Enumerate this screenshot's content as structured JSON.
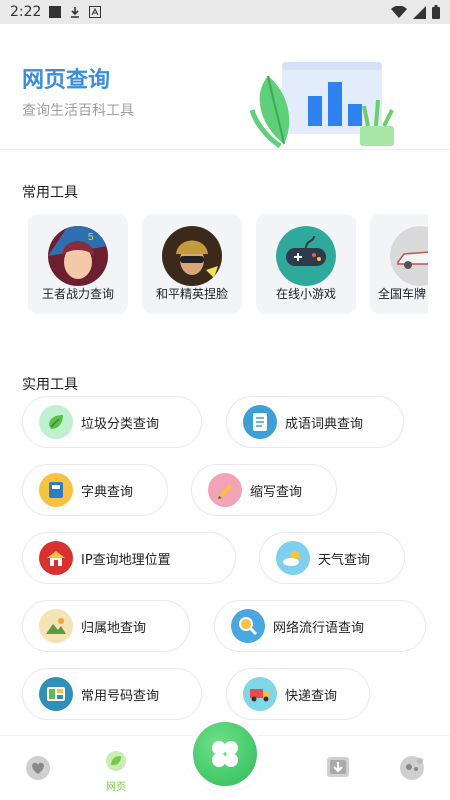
{
  "status_bar": {
    "time": "2:22"
  },
  "header": {
    "title": "网页查询",
    "subtitle": "查询生活百科工具"
  },
  "sections": {
    "common": "常用工具",
    "practical": "实用工具"
  },
  "common_tools": [
    {
      "label": "王者战力查询",
      "icon": "hero-avatar"
    },
    {
      "label": "和平精英捏脸",
      "icon": "soldier-avatar"
    },
    {
      "label": "在线小游戏",
      "icon": "gamepad-icon"
    },
    {
      "label": "全国车牌",
      "icon": "car-icon"
    }
  ],
  "practical_tools": [
    {
      "label": "垃圾分类查询",
      "icon": "leaf-icon",
      "color": "#bff0cf"
    },
    {
      "label": "成语词典查询",
      "icon": "document-icon",
      "color": "#3d9fd3"
    },
    {
      "label": "字典查询",
      "icon": "book-icon",
      "color": "#f5c242"
    },
    {
      "label": "缩写查询",
      "icon": "pencil-icon",
      "color": "#f2a3b5"
    },
    {
      "label": "IP查询地理位置",
      "icon": "house-icon",
      "color": "#d9322e"
    },
    {
      "label": "天气查询",
      "icon": "sun-cloud-icon",
      "color": "#7fd0ef"
    },
    {
      "label": "归属地查询",
      "icon": "landscape-icon",
      "color": "#f3e3b5"
    },
    {
      "label": "网络流行语查询",
      "icon": "magnifier-icon",
      "color": "#4aa8e0"
    },
    {
      "label": "常用号码查询",
      "icon": "layout-icon",
      "color": "#2f8fb8"
    },
    {
      "label": "快递查询",
      "icon": "truck-icon",
      "color": "#7fd7e8"
    }
  ],
  "bottom_nav": {
    "active_label": "网页"
  },
  "colors": {
    "accent": "#3a8de0",
    "green": "#2dbb58",
    "nav_active": "#7cc84f"
  }
}
